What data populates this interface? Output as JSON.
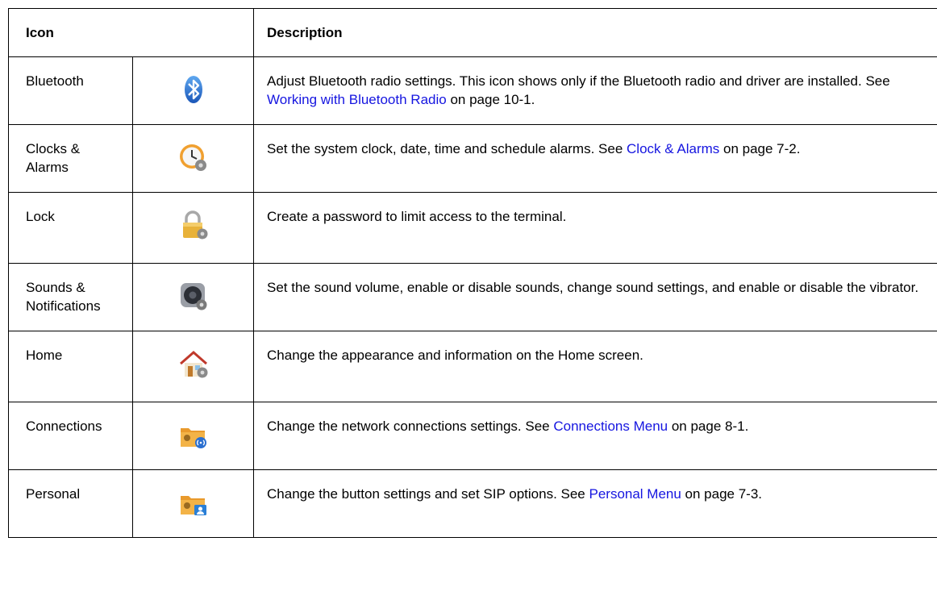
{
  "header": {
    "icon": "Icon",
    "description": "Description"
  },
  "rows": [
    {
      "name": "Bluetooth",
      "icon": "bluetooth-icon",
      "desc_before": "Adjust Bluetooth radio settings. This icon shows only if the Bluetooth radio and driver are installed. See ",
      "link": "Working with Bluetooth Radio",
      "desc_after": " on page 10-1."
    },
    {
      "name": "Clocks & Alarms",
      "icon": "clock-gear-icon",
      "desc_before": "Set the system clock, date, time and schedule alarms. See ",
      "link": "Clock & Alarms",
      "desc_after": " on page 7-2."
    },
    {
      "name": "Lock",
      "icon": "lock-gear-icon",
      "desc_before": "Create a password to limit access to the terminal.",
      "link": "",
      "desc_after": ""
    },
    {
      "name": "Sounds & Notifications",
      "icon": "speaker-gear-icon",
      "desc_before": "Set the sound volume, enable or disable sounds, change sound settings, and enable or disable the vibrator.",
      "link": "",
      "desc_after": ""
    },
    {
      "name": "Home",
      "icon": "home-gear-icon",
      "desc_before": "Change the appearance and information on the Home screen.",
      "link": "",
      "desc_after": ""
    },
    {
      "name": "Connections",
      "icon": "folder-wireless-icon",
      "desc_before": "Change the network connections settings. See ",
      "link": "Connections Menu",
      "desc_after": " on page 8-1."
    },
    {
      "name": "Personal",
      "icon": "folder-contact-icon",
      "desc_before": "Change the button settings and set SIP options. See ",
      "link": "Personal Menu",
      "desc_after": " on page 7-3."
    }
  ],
  "colors": {
    "link": "#1515e0",
    "border": "#000000"
  }
}
